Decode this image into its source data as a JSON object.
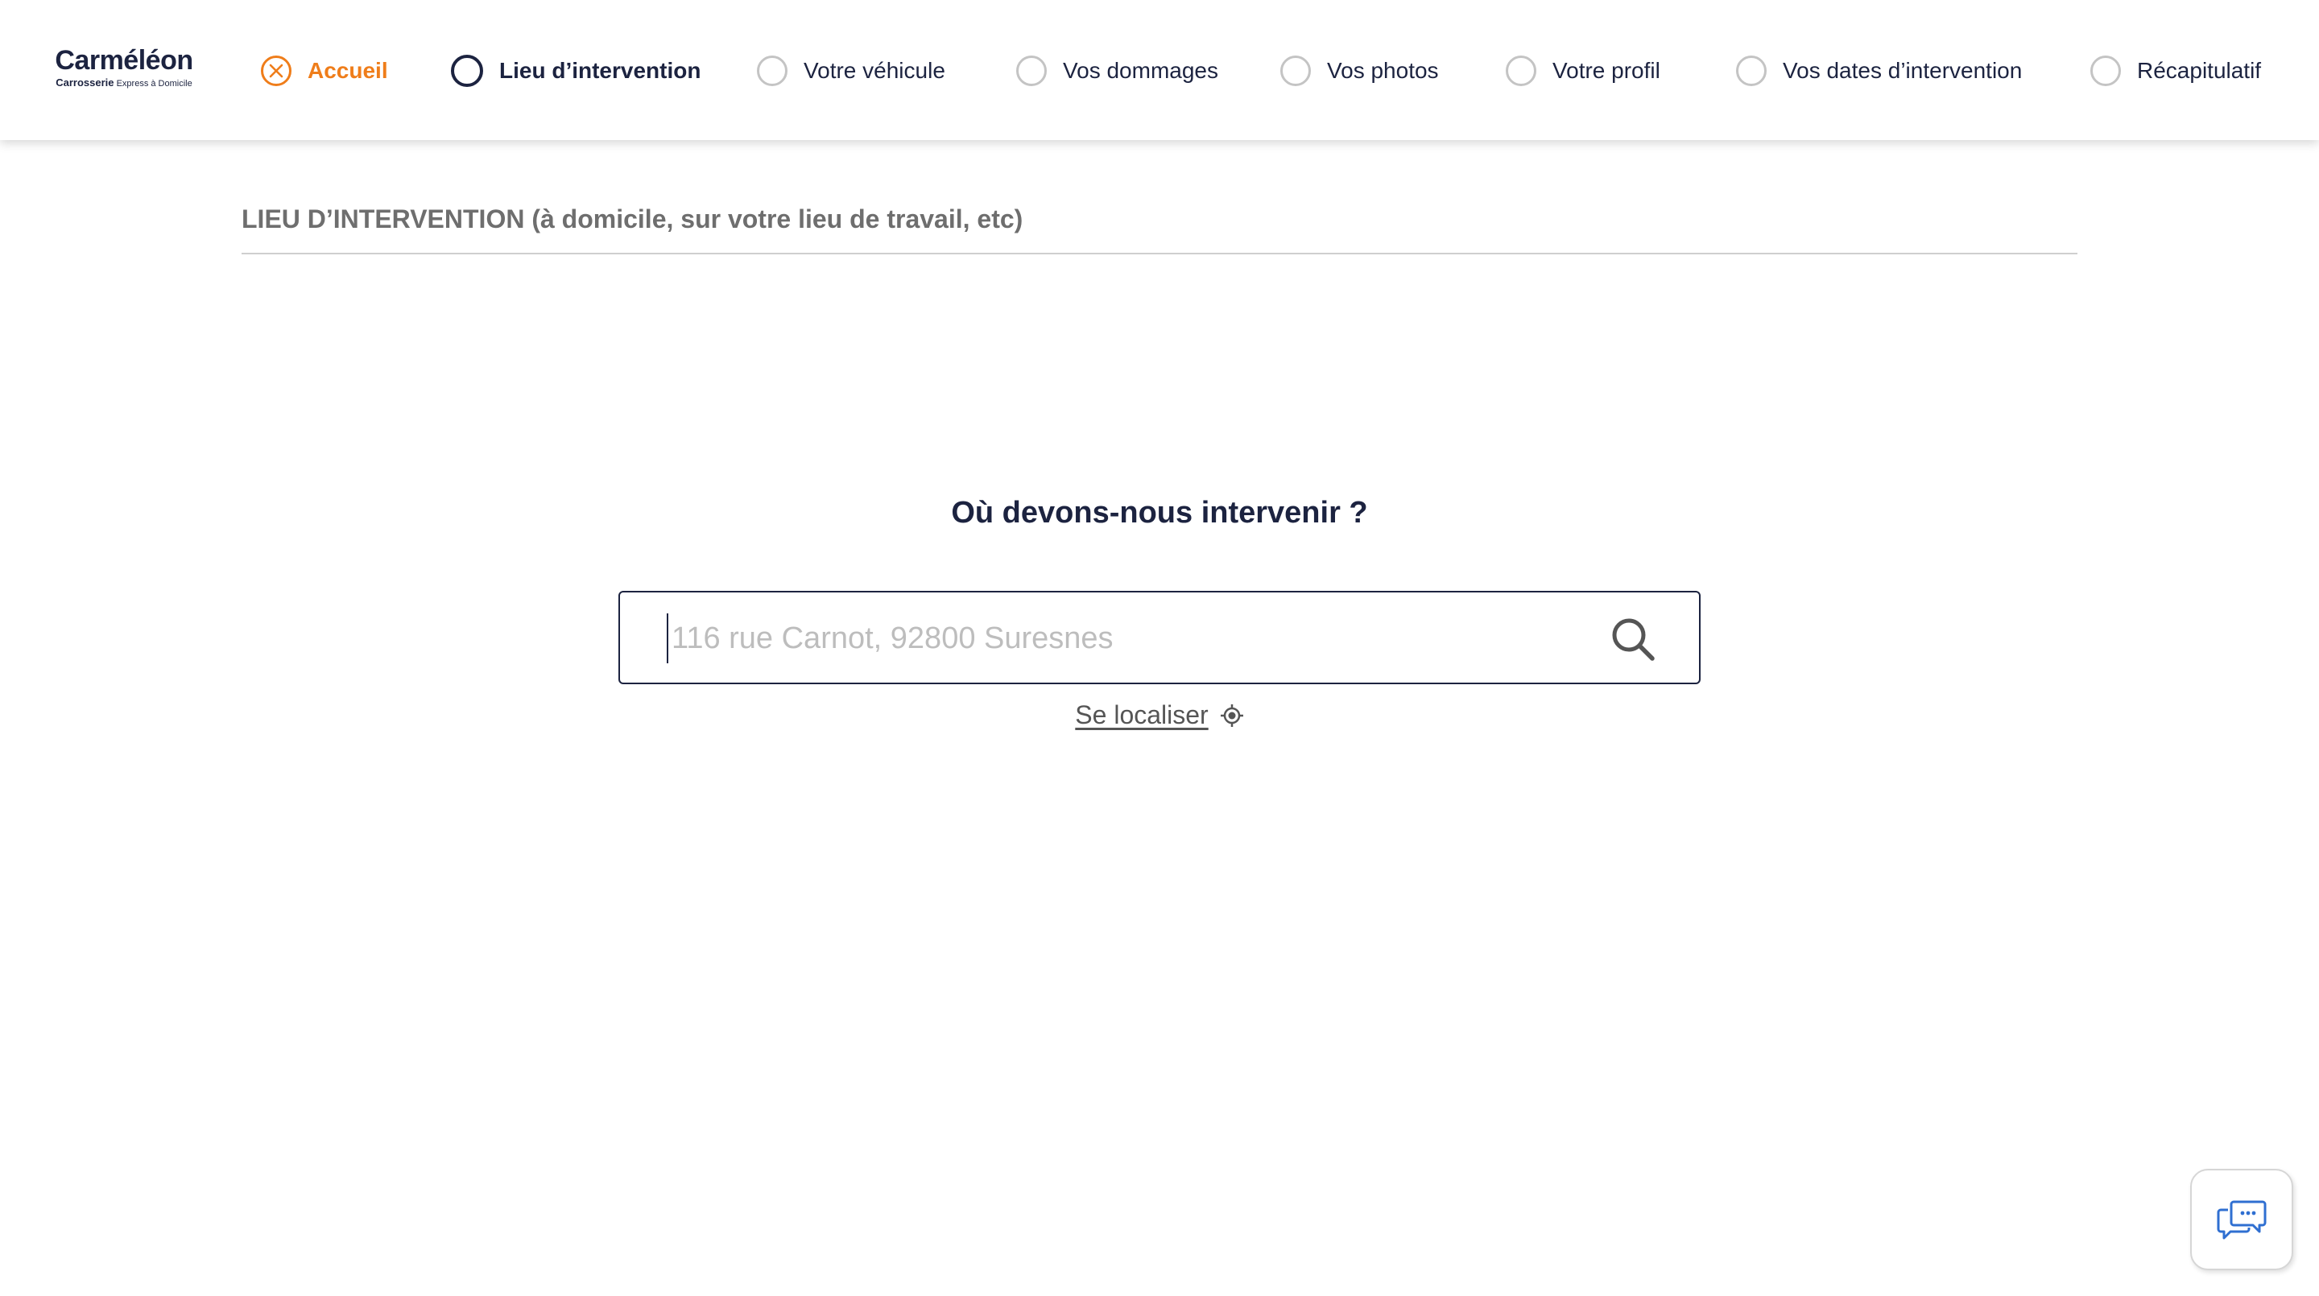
{
  "logo": {
    "name": "Carméléon",
    "tagline_bold": "Carrosserie",
    "tagline": "Express à Domicile"
  },
  "steps": [
    {
      "label": "Accueil",
      "state": "home",
      "icon": "close-circle-icon"
    },
    {
      "label": "Lieu d’intervention",
      "state": "active"
    },
    {
      "label": "Votre véhicule",
      "state": "pending"
    },
    {
      "label": "Vos dommages",
      "state": "pending"
    },
    {
      "label": "Vos photos",
      "state": "pending"
    },
    {
      "label": "Votre profil",
      "state": "pending"
    },
    {
      "label": "Vos dates d’intervention",
      "state": "pending"
    },
    {
      "label": "Récapitulatif",
      "state": "pending"
    }
  ],
  "section": {
    "title": "LIEU D’INTERVENTION (à domicile, sur votre lieu de travail, etc)"
  },
  "main": {
    "question": "Où devons-nous intervenir ?",
    "search": {
      "value": "",
      "placeholder": "116 rue Carnot, 92800 Suresnes",
      "icon": "search-icon"
    },
    "locate_label": "Se localiser",
    "locate_icon": "crosshair-icon"
  },
  "chat": {
    "icon": "chat-bubbles-icon"
  },
  "colors": {
    "primary": "#1c2340",
    "accent": "#ef7d1a",
    "inactive": "#c4c4c4",
    "muted_text": "#6e6e6e",
    "chat_icon": "#2f6fd1"
  }
}
